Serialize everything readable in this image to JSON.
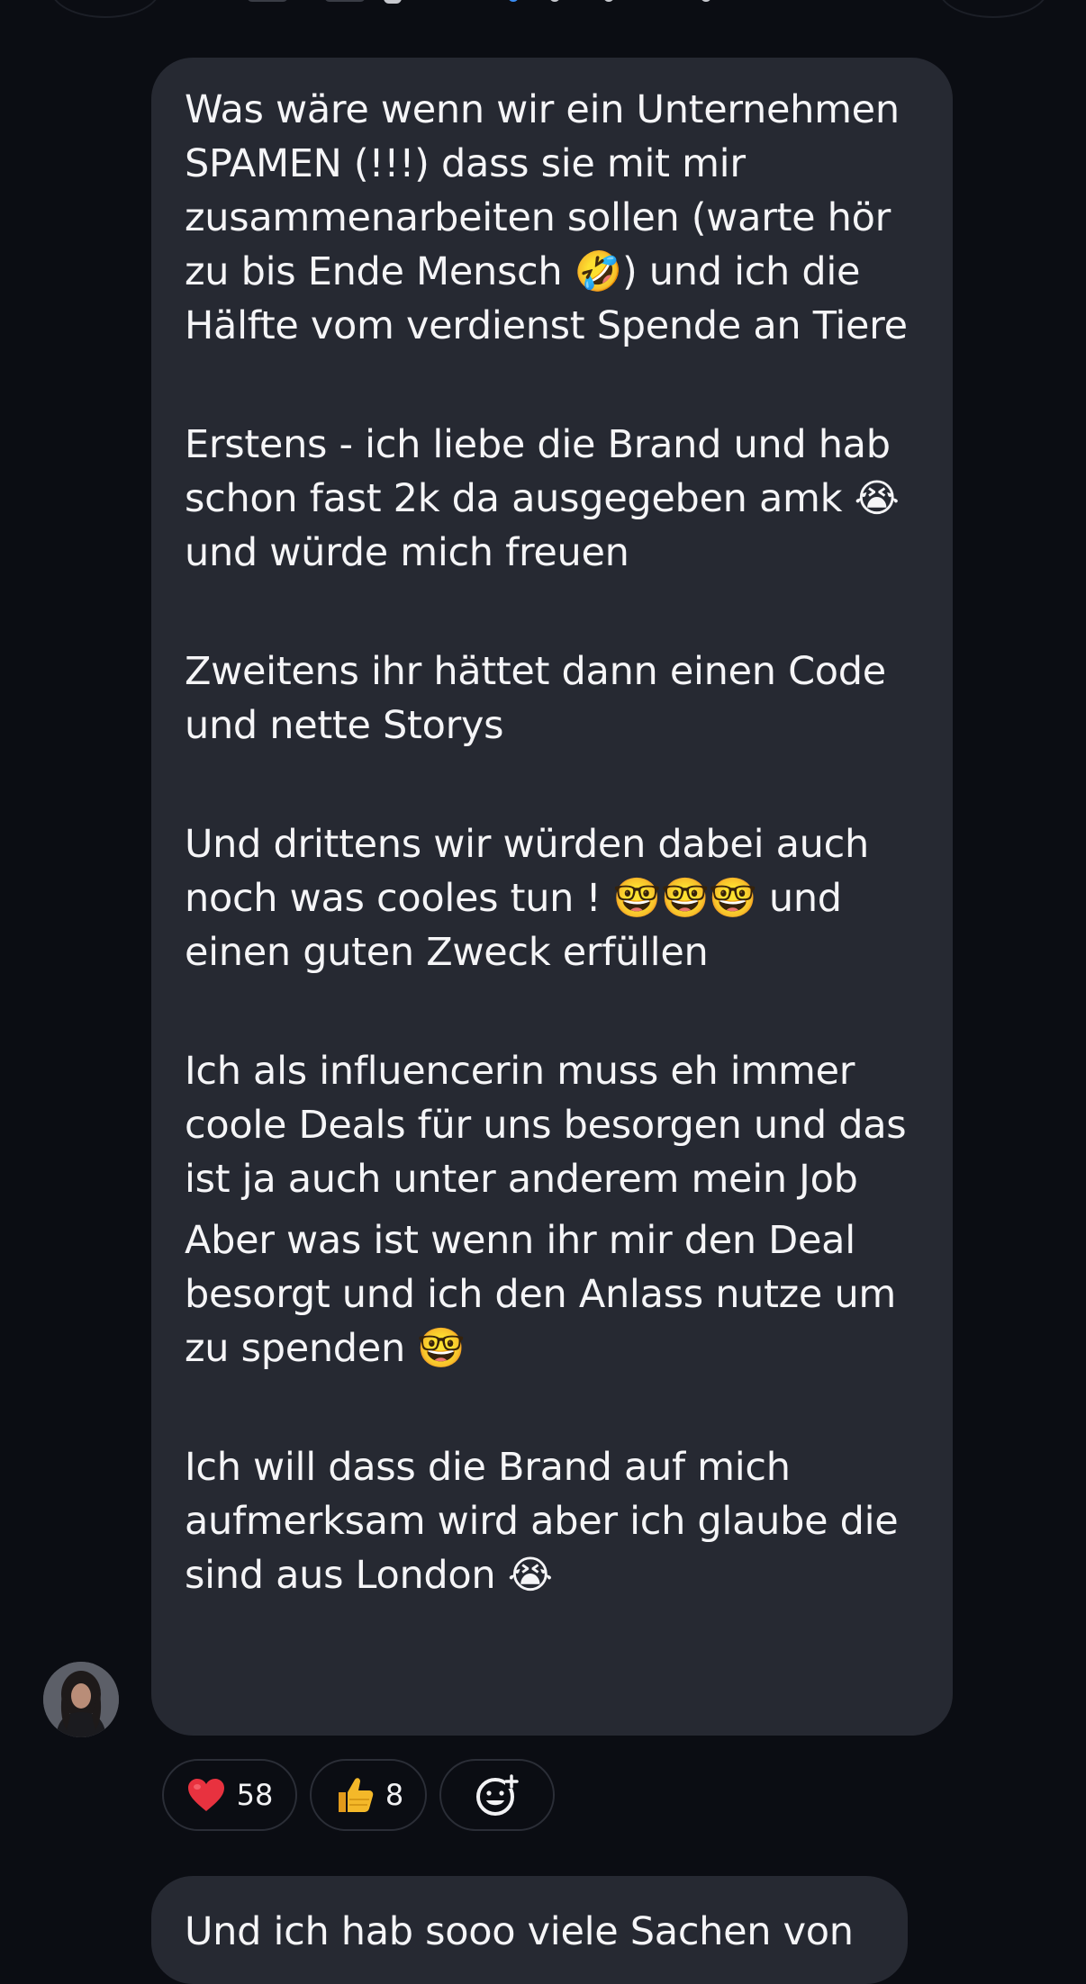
{
  "message": {
    "paragraphs": [
      "Was wäre wenn wir ein Unternehmen SPAMEN (!!!) dass sie mit mir zusammenarbeiten sollen (warte hör zu bis Ende Mensch 🤣) und ich die Hälfte vom verdienst Spende an Tiere",
      "Erstens - ich liebe die Brand und hab schon fast 2k da ausgegeben amk 😭 und würde mich freuen",
      "Zweitens ihr hättet dann einen Code und nette Storys",
      "Und drittens wir würden dabei auch noch was cooles tun ! 🤓🤓🤓 und einen guten Zweck erfüllen",
      "Ich als influencerin muss eh immer coole Deals für uns besorgen und das ist ja auch unter anderem mein Job",
      "Aber was ist wenn ihr mir den Deal besorgt und ich den Anlass nutze um zu spenden 🤓",
      "Ich will dass die Brand auf mich aufmerksam wird aber ich glaube die sind aus London 😭"
    ]
  },
  "reactions": [
    {
      "icon": "heart-icon",
      "emoji": "❤️",
      "count": "58"
    },
    {
      "icon": "thumbs-up-icon",
      "emoji": "👍",
      "count": "8"
    },
    {
      "icon": "add-reaction-icon"
    }
  ],
  "next_message": {
    "preview": "Und ich hab sooo viele Sachen von"
  },
  "colors": {
    "background": "#0b0d13",
    "bubble": "#262932",
    "pill_border": "#2b2e37",
    "text": "#f5f5f7",
    "heart": "#e8323f",
    "thumb": "#f4b829"
  }
}
